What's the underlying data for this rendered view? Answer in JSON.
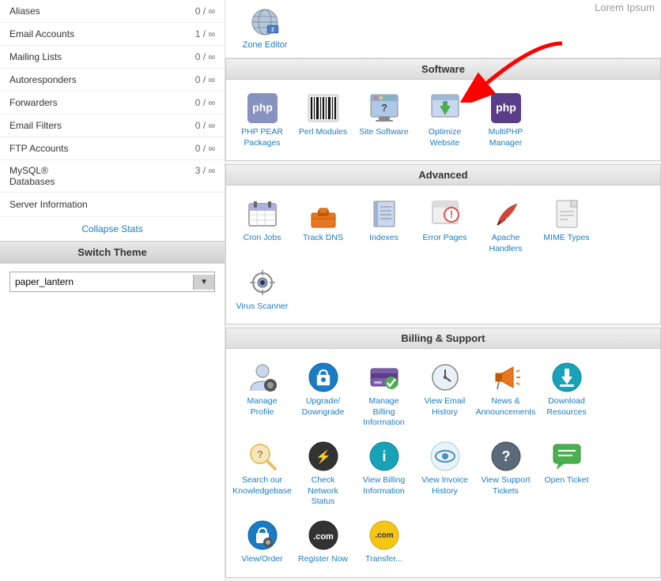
{
  "lorem_ipsum": "Lorem Ipsum",
  "sidebar": {
    "rows": [
      {
        "label": "Aliases",
        "count": "0 / ∞"
      },
      {
        "label": "Email Accounts",
        "count": "1 / ∞"
      },
      {
        "label": "Mailing Lists",
        "count": "0 / ∞"
      },
      {
        "label": "Autoresponders",
        "count": "0 / ∞"
      },
      {
        "label": "Forwarders",
        "count": "0 / ∞"
      },
      {
        "label": "Email Filters",
        "count": "0 / ∞"
      },
      {
        "label": "FTP Accounts",
        "count": "0 / ∞"
      },
      {
        "label": "MySQL® Databases",
        "count": "3 / ∞"
      }
    ],
    "server_info": "Server Information",
    "collapse_stats": "Collapse Stats",
    "switch_theme_header": "Switch Theme",
    "theme_options": [
      "paper_lantern"
    ],
    "theme_selected": "paper_lantern"
  },
  "top_section": {
    "zone_editor_label": "Zone Editor"
  },
  "sections": {
    "software": {
      "header": "Software",
      "items": [
        {
          "label": "PHP PEAR\nPackages",
          "icon": "php-pear-icon"
        },
        {
          "label": "Perl Modules",
          "icon": "perl-modules-icon"
        },
        {
          "label": "Site Software",
          "icon": "site-software-icon"
        },
        {
          "label": "Optimize\nWebsite",
          "icon": "optimize-website-icon"
        },
        {
          "label": "MultiPHP\nManager",
          "icon": "multiphp-manager-icon"
        }
      ]
    },
    "advanced": {
      "header": "Advanced",
      "items": [
        {
          "label": "Cron Jobs",
          "icon": "cron-jobs-icon"
        },
        {
          "label": "Track DNS",
          "icon": "track-dns-icon"
        },
        {
          "label": "Indexes",
          "icon": "indexes-icon"
        },
        {
          "label": "Error Pages",
          "icon": "error-pages-icon"
        },
        {
          "label": "Apache\nHandlers",
          "icon": "apache-handlers-icon"
        },
        {
          "label": "MIME Types",
          "icon": "mime-types-icon"
        },
        {
          "label": "Virus Scanner",
          "icon": "virus-scanner-icon"
        }
      ]
    },
    "billing_support": {
      "header": "Billing & Support",
      "items": [
        {
          "label": "Manage\nProfile",
          "icon": "manage-profile-icon"
        },
        {
          "label": "Upgrade/Downgrade",
          "icon": "upgrade-downgrade-icon"
        },
        {
          "label": "Manage\nBilling\nInformation",
          "icon": "manage-billing-icon"
        },
        {
          "label": "View Email\nHistory",
          "icon": "view-email-history-icon"
        },
        {
          "label": "News &\nAnnouncements",
          "icon": "news-icon"
        },
        {
          "label": "Download\nResources",
          "icon": "download-resources-icon"
        },
        {
          "label": "Search our\nKnowledgebase",
          "icon": "search-knowledgebase-icon"
        },
        {
          "label": "Check\nNetwork\nStatus",
          "icon": "check-network-icon"
        },
        {
          "label": "View Billing\nInformation",
          "icon": "view-billing-icon"
        },
        {
          "label": "View Invoice\nHistory",
          "icon": "view-invoice-icon"
        },
        {
          "label": "View Support\nTickets",
          "icon": "view-support-icon"
        },
        {
          "label": "Open Ticket",
          "icon": "open-ticket-icon"
        },
        {
          "label": "View/Order",
          "icon": "view-order-icon"
        },
        {
          "label": "Register Now",
          "icon": "register-now-icon"
        },
        {
          "label": "Transfer...",
          "icon": "transfer-icon"
        }
      ]
    }
  }
}
